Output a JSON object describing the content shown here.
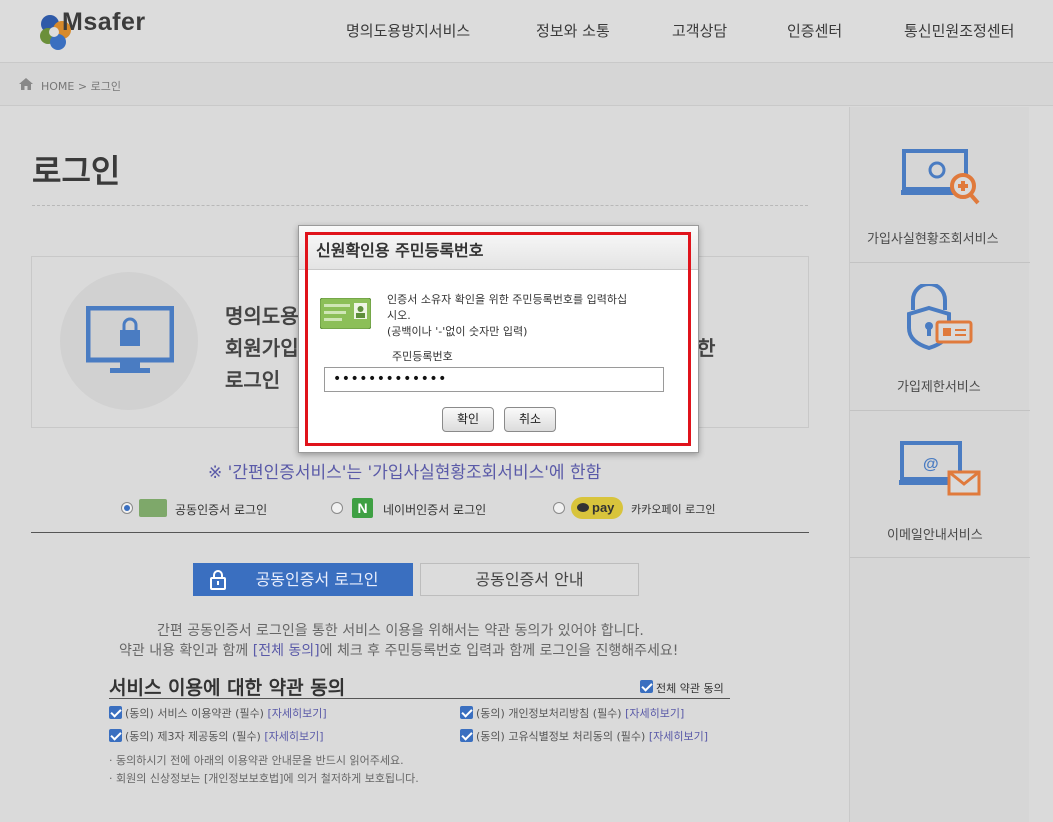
{
  "header": {
    "logo_text": "Msafer",
    "nav": [
      "명의도용방지서비스",
      "정보와 소통",
      "고객상담",
      "인증센터",
      "통신민원조정센터"
    ]
  },
  "breadcrumb": "HOME > 로그인",
  "page_title": "로그인",
  "info_lines": [
    "명의도용",
    "회원가입",
    "로그인"
  ],
  "info_line_tail": "한",
  "notice": "※ '간편인증서비스'는 '가입사실현황조회서비스'에 한함",
  "login_options": [
    {
      "label": "공동인증서 로그인",
      "selected": true
    },
    {
      "label": "네이버인증서 로그인",
      "selected": false,
      "icon_text": "N"
    },
    {
      "label": "카카오페이 로그인",
      "selected": false,
      "icon_text": "pay"
    }
  ],
  "tabs": {
    "active": "공동인증서 로그인",
    "inactive": "공동인증서 안내"
  },
  "description": {
    "line1": "간편 공동인증서 로그인을 통한 서비스 이용을 위해서는 약관 동의가 있어야 합니다.",
    "line2_pre": "약관 내용 확인과 함께 ",
    "line2_link": "[전체 동의]",
    "line2_post": "에 체크 후 주민등록번호 입력과 함께 로그인을 진행해주세요!"
  },
  "terms": {
    "title": "서비스 이용에 대한 약관 동의",
    "agree_all": "전체 약관 동의",
    "items": [
      {
        "text": "(동의) 서비스 이용약관 (필수)",
        "link": "[자세히보기]",
        "checked": true
      },
      {
        "text": "(동의) 개인정보처리방침 (필수)",
        "link": "[자세히보기]",
        "checked": true
      },
      {
        "text": "(동의) 제3자 제공동의 (필수)",
        "link": "[자세히보기]",
        "checked": true
      },
      {
        "text": "(동의) 고유식별정보 처리동의 (필수)",
        "link": "[자세히보기]",
        "checked": true
      }
    ],
    "notes": [
      "· 동의하시기 전에 아래의 이용약관 안내문을 반드시 읽어주세요.",
      "· 회원의 신상정보는 [개인정보보호법]에 의거 철저하게 보호됩니다."
    ]
  },
  "sidebar": [
    "가입사실현황조회서비스",
    "가입제한서비스",
    "이메일안내서비스"
  ],
  "dialog": {
    "title": "신원확인용 주민등록번호",
    "message_line1": "인증서 소유자 확인을 위한 주민등록번호를 입력하십",
    "message_line2": "시오.",
    "message_line3": "(공백이나 '-'없이 숫자만 입력)",
    "field_label": "주민등록번호",
    "field_value": "•••••••••••••",
    "ok_label": "확인",
    "cancel_label": "취소"
  },
  "colors": {
    "accent": "#3a6fc0",
    "highlight_frame": "#e0131b",
    "link": "#5a5aa8"
  }
}
